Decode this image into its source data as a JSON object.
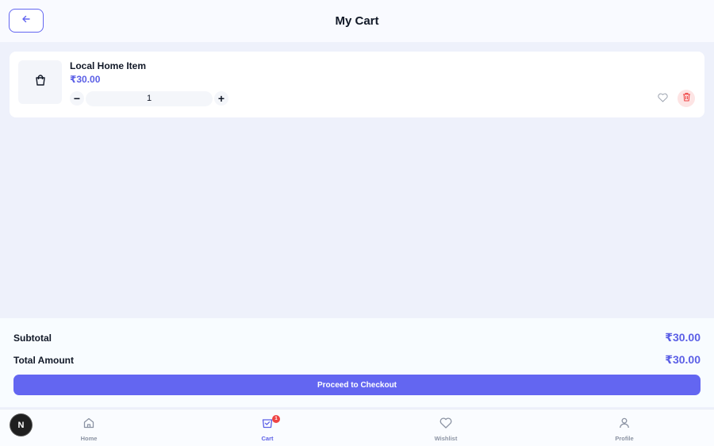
{
  "header": {
    "title": "My Cart",
    "back_icon": "arrow-left-icon"
  },
  "cart": {
    "items": [
      {
        "name": "Local Home Item",
        "price": "₹30.00",
        "quantity": "1",
        "thumb_icon": "shopping-bag-icon",
        "decrement_label": "−",
        "increment_label": "+"
      }
    ]
  },
  "summary": {
    "subtotal_label": "Subtotal",
    "subtotal_value": "₹30.00",
    "total_label": "Total Amount",
    "total_value": "₹30.00",
    "checkout_label": "Proceed to Checkout"
  },
  "nav": {
    "items": [
      {
        "label": "Home",
        "icon": "home-icon"
      },
      {
        "label": "Cart",
        "icon": "cart-icon",
        "badge": "1",
        "active": true
      },
      {
        "label": "Wishlist",
        "icon": "heart-icon"
      },
      {
        "label": "Profile",
        "icon": "user-icon"
      }
    ],
    "logo": "N"
  },
  "colors": {
    "accent": "#6366f1",
    "price": "#5b5fe6",
    "badge": "#ef4444",
    "delete_bg": "#fde4e4"
  }
}
